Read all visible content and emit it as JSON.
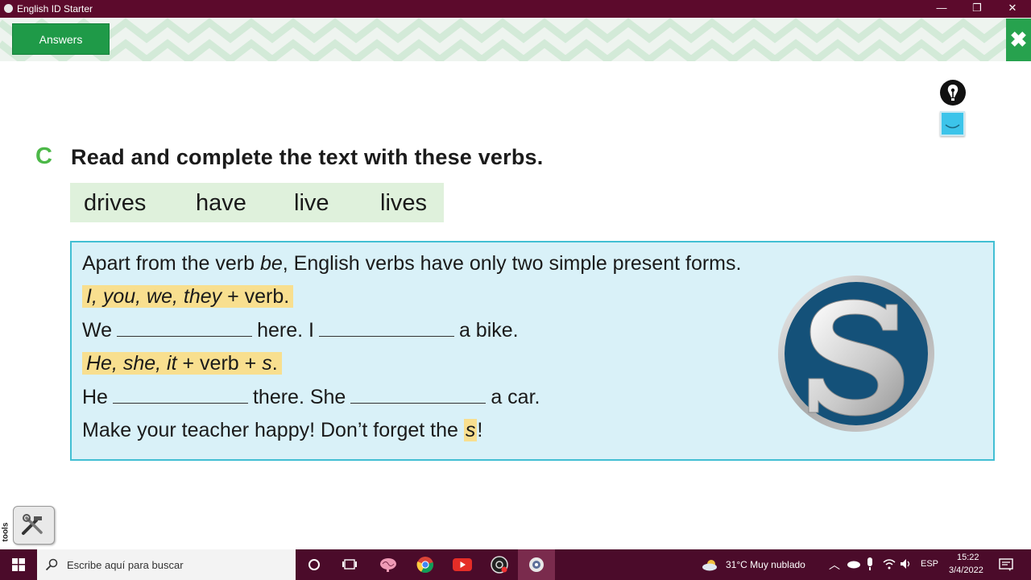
{
  "window": {
    "title": "English ID Starter",
    "minimize": "—",
    "restore": "❐",
    "close": "✕"
  },
  "toolbar": {
    "answers_label": "Answers",
    "close_label": "✖"
  },
  "exercise": {
    "letter": "C",
    "instruction": "Read and complete the text with these verbs.",
    "words": [
      "drives",
      "have",
      "live",
      "lives"
    ],
    "box": {
      "line1_a": "Apart from the verb ",
      "line1_b": "be",
      "line1_c": ", English verbs have only two simple present forms.",
      "rule1_a": "I, you, we, they",
      "rule1_b": " + verb.",
      "sent1_a": "We",
      "sent1_b": "here. I",
      "sent1_c": "a bike.",
      "rule2_a": "He, she, it",
      "rule2_b": " + verb + ",
      "rule2_c": "s",
      "rule2_d": ".",
      "sent2_a": "He",
      "sent2_b": "there. She",
      "sent2_c": "a car.",
      "tip_a": "Make your teacher happy! Don’t forget the ",
      "tip_b": "s",
      "tip_c": "!"
    }
  },
  "itools": {
    "label": "i-tools"
  },
  "taskbar": {
    "search_placeholder": "Escribe aquí para buscar",
    "weather": "31°C  Muy nublado",
    "language": "ESP",
    "time": "15:22",
    "date": "3/4/2022"
  },
  "colors": {
    "titlebar": "#5c0a2c",
    "accent_green": "#1f9a48",
    "box_bg": "#d9f1f8",
    "box_border": "#42bfd3",
    "highlight": "#f8df8f",
    "wordbank_bg": "#dff1dc"
  }
}
